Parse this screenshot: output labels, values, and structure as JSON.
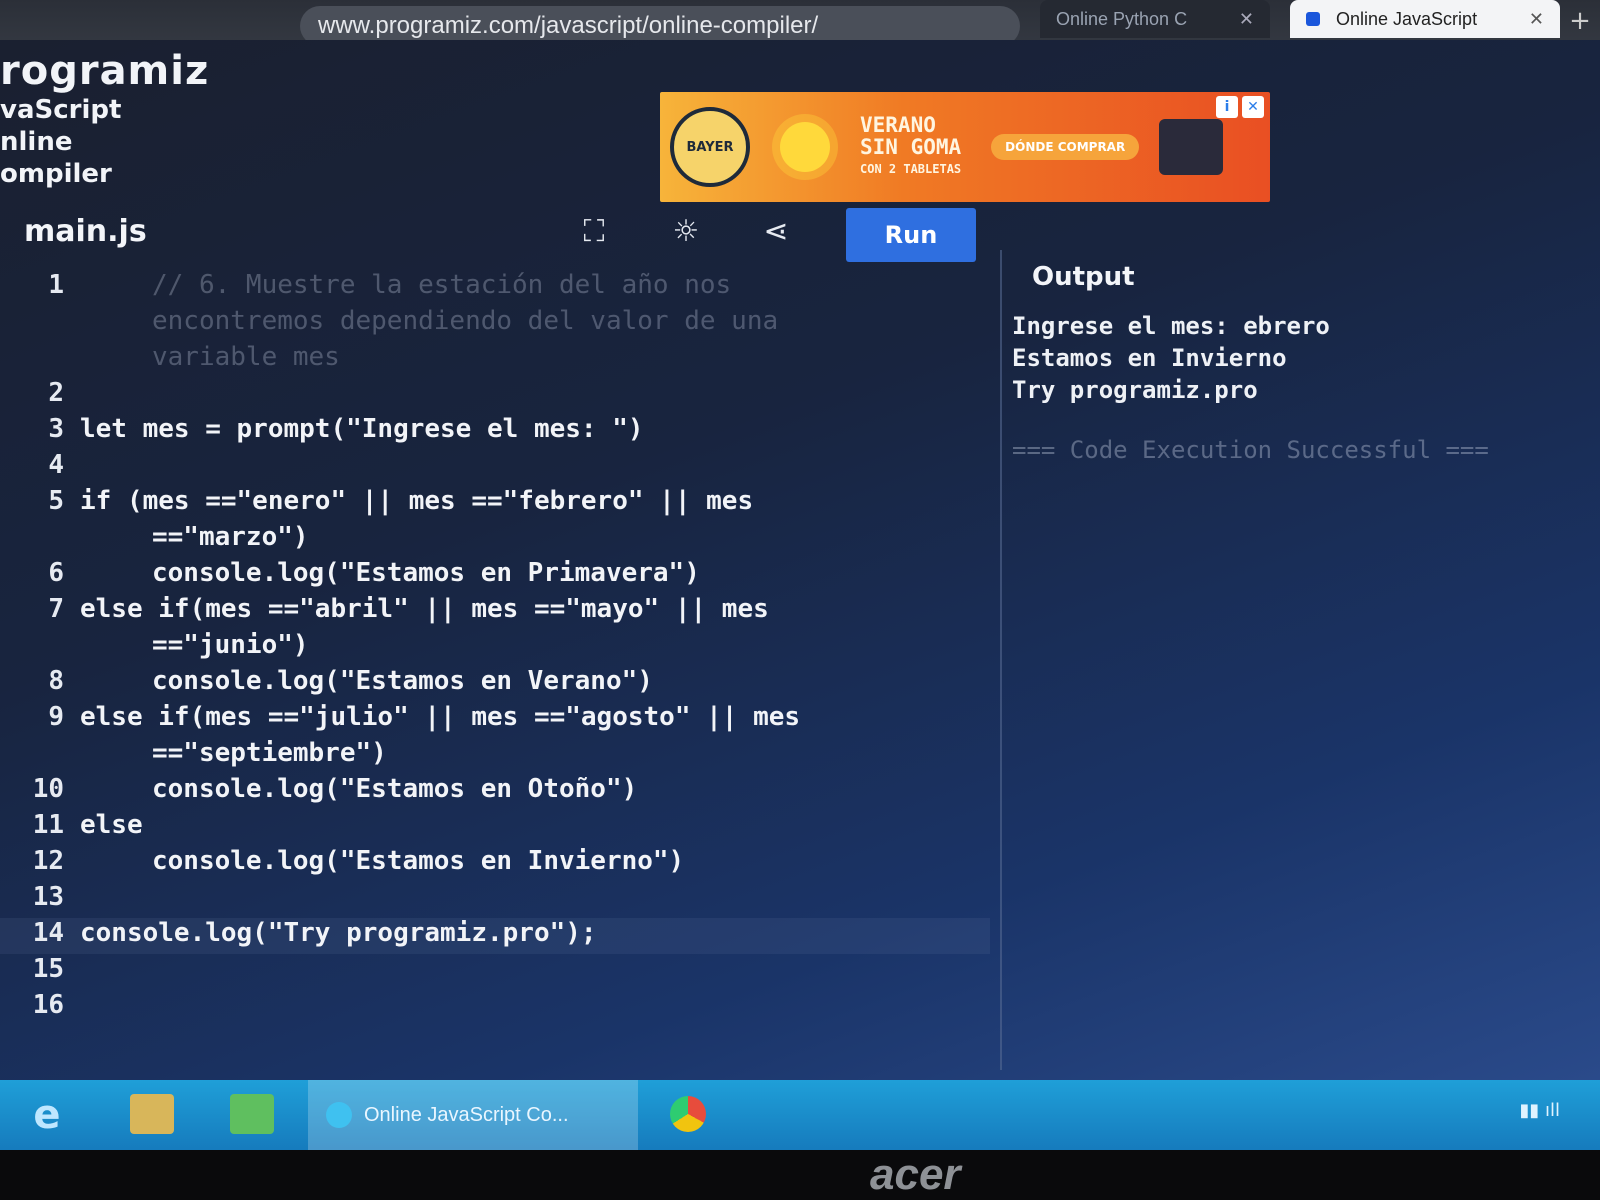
{
  "browser": {
    "url": "www.programiz.com/javascript/online-compiler/",
    "tabs": [
      {
        "label": "Online Python C",
        "active": false
      },
      {
        "label": "Online JavaScript",
        "active": true
      }
    ],
    "close_glyph": "✕",
    "new_tab_glyph": "+",
    "toolbar_icons": [
      "read-aloud-icon",
      "add-favorite-icon",
      "favorites-icon"
    ]
  },
  "brand": {
    "name": "rogramiz",
    "subtitle_lines": [
      "vaScript",
      "nline",
      "ompiler"
    ]
  },
  "ad": {
    "logo_text": "BAYER",
    "headline_1": "VERANO",
    "headline_2": "SIN GOMA",
    "headline_3": "CON 2 TABLETAS",
    "cta": "DÓNDE COMPRAR",
    "info_glyph": "i",
    "close_glyph": "✕"
  },
  "editor": {
    "file_name": "main.js",
    "run_label": "Run",
    "icons": [
      "fullscreen-icon",
      "theme-icon",
      "share-icon"
    ],
    "lines": [
      {
        "n": "1",
        "text": "// 6. Muestre la estación del año nos",
        "type": "comment"
      },
      {
        "n": "",
        "text": "encontremos dependiendo del valor de una",
        "type": "comment"
      },
      {
        "n": "",
        "text": "variable mes",
        "type": "comment"
      },
      {
        "n": "2",
        "text": "",
        "type": "code"
      },
      {
        "n": "3",
        "text": "let mes = prompt(\"Ingrese el mes: \")",
        "type": "code"
      },
      {
        "n": "4",
        "text": "",
        "type": "code"
      },
      {
        "n": "5",
        "text": "if (mes ==\"enero\" || mes ==\"febrero\" || mes",
        "type": "code"
      },
      {
        "n": "",
        "text": "==\"marzo\")",
        "type": "indent"
      },
      {
        "n": "6",
        "text": "console.log(\"Estamos en Primavera\")",
        "type": "indent"
      },
      {
        "n": "7",
        "text": "else if(mes ==\"abril\" || mes ==\"mayo\" || mes",
        "type": "code"
      },
      {
        "n": "",
        "text": "==\"junio\")",
        "type": "indent"
      },
      {
        "n": "8",
        "text": "console.log(\"Estamos en Verano\")",
        "type": "indent"
      },
      {
        "n": "9",
        "text": "else if(mes ==\"julio\" || mes ==\"agosto\" || mes",
        "type": "code"
      },
      {
        "n": "",
        "text": "==\"septiembre\")",
        "type": "indent"
      },
      {
        "n": "10",
        "text": "console.log(\"Estamos en Otoño\")",
        "type": "indent"
      },
      {
        "n": "11",
        "text": "else",
        "type": "code"
      },
      {
        "n": "12",
        "text": "console.log(\"Estamos en Invierno\")",
        "type": "indent"
      },
      {
        "n": "13",
        "text": "",
        "type": "code"
      },
      {
        "n": "14",
        "text": "console.log(\"Try programiz.pro\");",
        "type": "active"
      },
      {
        "n": "15",
        "text": "",
        "type": "code"
      },
      {
        "n": "16",
        "text": "",
        "type": "code"
      }
    ]
  },
  "output": {
    "title": "Output",
    "lines": [
      "Ingrese el mes: ebrero",
      "Estamos en Invierno",
      "Try programiz.pro"
    ],
    "status": "=== Code Execution Successful ==="
  },
  "taskbar": {
    "start_glyph": "e",
    "window_label": "Online JavaScript Co..."
  },
  "monitor": {
    "brand": "acer"
  }
}
